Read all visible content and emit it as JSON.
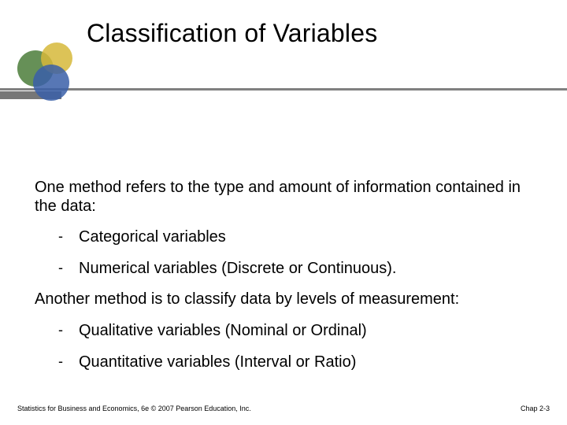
{
  "title": "Classification of Variables",
  "intro": "One method refers to the type and amount of information contained in the data:",
  "list1": {
    "a": "Categorical variables",
    "b": "Numerical variables (Discrete or Continuous)."
  },
  "second": "Another method is to classify data by levels of measurement:",
  "list2": {
    "a": "Qualitative variables (Nominal or Ordinal)",
    "b": "Quantitative variables (Interval or Ratio)"
  },
  "footer": {
    "left": "Statistics for Business and Economics, 6e © 2007 Pearson Education, Inc.",
    "right": "Chap 2-3"
  }
}
